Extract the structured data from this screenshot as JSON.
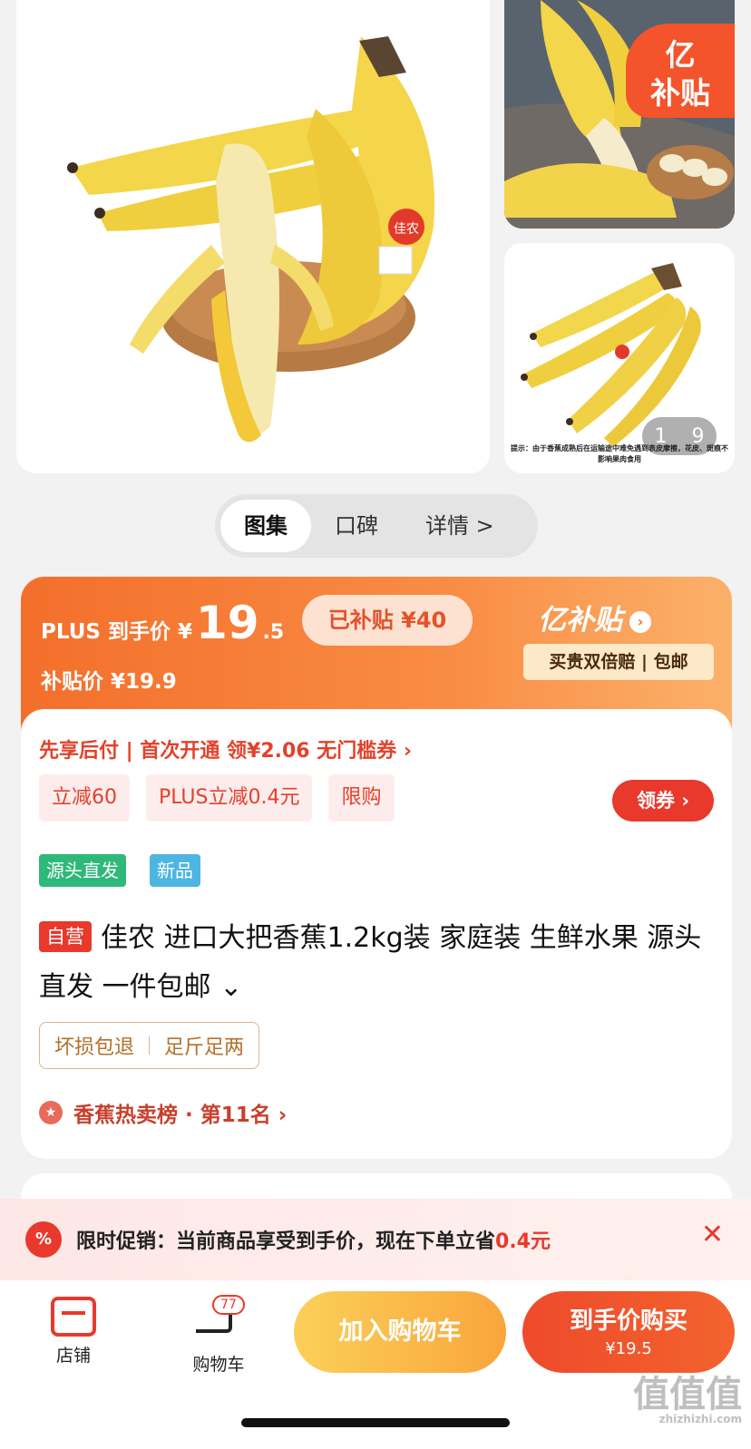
{
  "gallery": {
    "side_badge_line1": "亿",
    "side_badge_line2": "补贴",
    "image_counter_current": "1",
    "image_counter_total": "9",
    "image_tip": "提示：由于香蕉成熟后在运输途中难免遇到表皮摩擦，花皮、斑痕不影响果肉食用",
    "product_label": "佳农"
  },
  "tabs": [
    {
      "label": "图集",
      "active": true
    },
    {
      "label": "口碑",
      "active": false
    },
    {
      "label": "详情 >",
      "active": false
    }
  ],
  "price": {
    "plus_label": "PLUS 到手价 ¥",
    "plus_int": "19",
    "plus_dec": ".5",
    "subsidized_pill": "已补贴 ¥40",
    "subsidy_price": "补贴价 ¥19.9",
    "yi_brand": "亿补贴",
    "yi_arrow": "›",
    "yi_sub": "买贵双倍赔 | 包邮"
  },
  "offers": {
    "credit_line": "先享后付 | 首次开通 领¥2.06 无门槛券 ›",
    "tags": [
      "立减60",
      "PLUS立减0.4元",
      "限购"
    ],
    "coupon_button": "领券 ›"
  },
  "product": {
    "source_tag": "源头直发",
    "new_tag": "新品",
    "self_operated": "自营",
    "title": "佳农 进口大把香蕉1.2kg装 家庭装 生鲜水果 源头直发 一件包邮",
    "title_expand": "⌄",
    "guarantees": [
      "坏损包退",
      "足斤足两"
    ],
    "ranking": "香蕉热卖榜 · 第11名 ›"
  },
  "promo": {
    "icon": "%",
    "text": "限时促销：当前商品享受到手价，现在下单立省",
    "amount": "0.4元",
    "close": "✕"
  },
  "bottom_bar": {
    "shop_label": "店铺",
    "cart_label": "购物车",
    "cart_count": "77",
    "add_to_cart": "加入购物车",
    "buy_line1": "到手价购买",
    "buy_line2": "¥19.5"
  },
  "watermark": {
    "main": "值值值",
    "url": "zhizhizhi.com"
  },
  "colors": {
    "accent_red": "#e8392c",
    "orange": "#f36f2b",
    "yellow_button": "#f9a53c",
    "green_tag": "#2eb87a",
    "blue_tag": "#4db6e0"
  }
}
